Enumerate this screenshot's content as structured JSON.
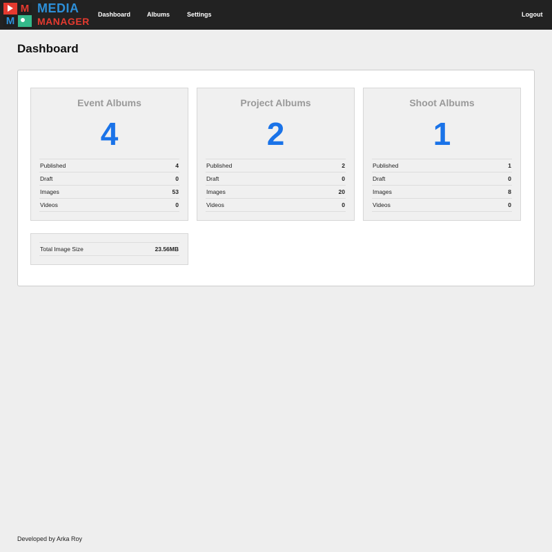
{
  "header": {
    "logo": {
      "line1": "MEDIA",
      "line2": "MANAGER",
      "tile_letter": "M"
    },
    "nav": [
      "Dashboard",
      "Albums",
      "Settings"
    ],
    "logout": "Logout"
  },
  "page_title": "Dashboard",
  "cards": [
    {
      "title": "Event Albums",
      "count": "4",
      "stats": [
        {
          "label": "Published",
          "value": "4"
        },
        {
          "label": "Draft",
          "value": "0"
        },
        {
          "label": "Images",
          "value": "53"
        },
        {
          "label": "Videos",
          "value": "0"
        }
      ]
    },
    {
      "title": "Project Albums",
      "count": "2",
      "stats": [
        {
          "label": "Published",
          "value": "2"
        },
        {
          "label": "Draft",
          "value": "0"
        },
        {
          "label": "Images",
          "value": "20"
        },
        {
          "label": "Videos",
          "value": "0"
        }
      ]
    },
    {
      "title": "Shoot Albums",
      "count": "1",
      "stats": [
        {
          "label": "Published",
          "value": "1"
        },
        {
          "label": "Draft",
          "value": "0"
        },
        {
          "label": "Images",
          "value": "8"
        },
        {
          "label": "Videos",
          "value": "0"
        }
      ]
    }
  ],
  "total_size": {
    "label": "Total Image Size",
    "value": "23.56MB"
  },
  "footer": "Developed by Arka Roy",
  "colors": {
    "topbar": "#222222",
    "accent_count": "#1a73e8",
    "logo_blue": "#2d8fd8",
    "logo_red": "#e53a2f",
    "logo_green": "#34b98a"
  },
  "icons": [
    "play-icon",
    "image-icon"
  ]
}
